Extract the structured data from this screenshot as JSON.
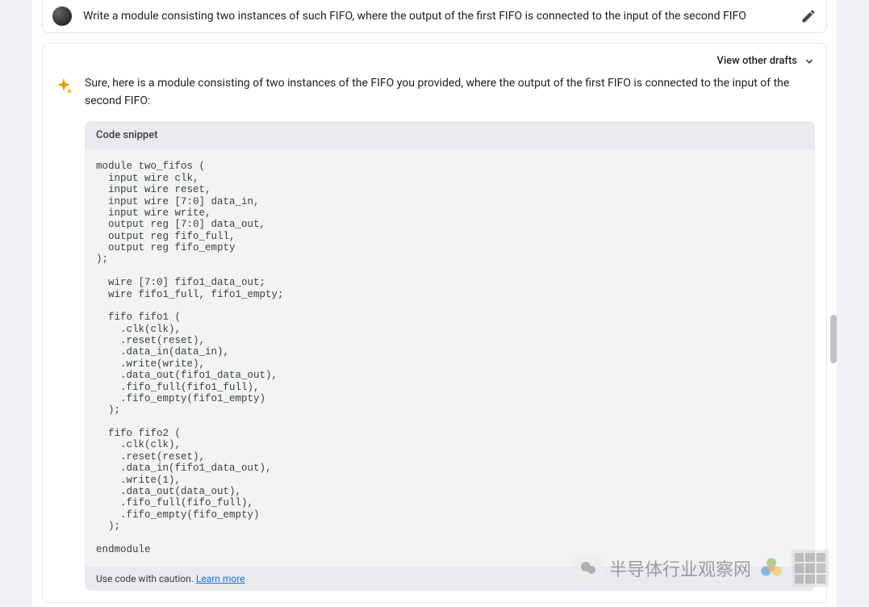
{
  "user_message": {
    "text": "Write a module consisting two instances of such FIFO, where the output of the first FIFO is connected to the input of the second FIFO"
  },
  "response": {
    "view_drafts_label": "View other drafts",
    "intro": "Sure, here is a module consisting of two instances of the FIFO you provided, where the output of the first FIFO is connected to the input of the second FIFO:",
    "code_header": "Code snippet",
    "code": "module two_fifos (\n  input wire clk,\n  input wire reset,\n  input wire [7:0] data_in,\n  input wire write,\n  output reg [7:0] data_out,\n  output reg fifo_full,\n  output reg fifo_empty\n);\n\n  wire [7:0] fifo1_data_out;\n  wire fifo1_full, fifo1_empty;\n\n  fifo fifo1 (\n    .clk(clk),\n    .reset(reset),\n    .data_in(data_in),\n    .write(write),\n    .data_out(fifo1_data_out),\n    .fifo_full(fifo1_full),\n    .fifo_empty(fifo1_empty)\n  );\n\n  fifo fifo2 (\n    .clk(clk),\n    .reset(reset),\n    .data_in(fifo1_data_out),\n    .write(1),\n    .data_out(data_out),\n    .fifo_full(fifo_full),\n    .fifo_empty(fifo_empty)\n  );\n\nendmodule",
    "caution_text": "Use code with caution. ",
    "learn_more": "Learn more"
  },
  "watermark": {
    "text": "半导体行业观察网"
  }
}
